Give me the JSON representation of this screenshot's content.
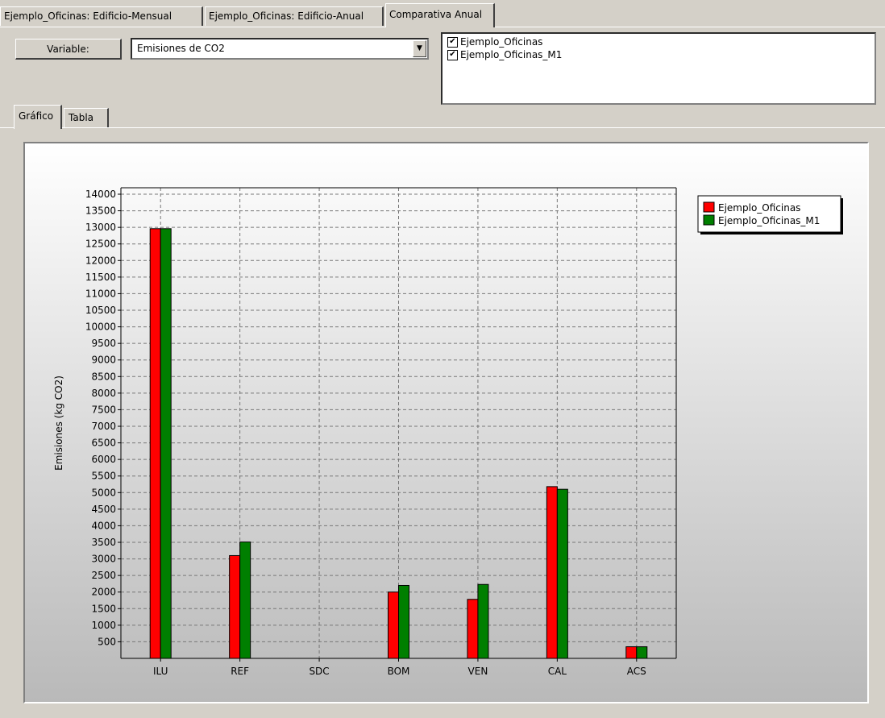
{
  "tabs": [
    {
      "label": "Ejemplo_Oficinas: Edificio-Mensual",
      "active": false
    },
    {
      "label": "Ejemplo_Oficinas: Edificio-Anual",
      "active": false
    },
    {
      "label": "Comparativa Anual",
      "active": true
    }
  ],
  "controls": {
    "variable_button": "Variable:",
    "variable_value": "Emisiones de CO2"
  },
  "cases": [
    {
      "label": "Ejemplo_Oficinas",
      "checked": true
    },
    {
      "label": "Ejemplo_Oficinas_M1",
      "checked": true
    }
  ],
  "subtabs": [
    {
      "label": "Gráfico",
      "active": true
    },
    {
      "label": "Tabla",
      "active": false
    }
  ],
  "colors": {
    "series1": "#ff0000",
    "series2": "#007f00"
  },
  "chart_data": {
    "type": "bar",
    "ylabel": "Emisiones (kg CO2)",
    "xlabel": "",
    "categories": [
      "ILU",
      "REF",
      "SDC",
      "BOM",
      "VEN",
      "CAL",
      "ACS"
    ],
    "ylim": [
      0,
      14000
    ],
    "yticks": [
      500,
      1000,
      1500,
      2000,
      2500,
      3000,
      3500,
      4000,
      4500,
      5000,
      5500,
      6000,
      6500,
      7000,
      7500,
      8000,
      8500,
      9000,
      9500,
      10000,
      10500,
      11000,
      11500,
      12000,
      12500,
      13000,
      13500,
      14000
    ],
    "grid": true,
    "legend": "top-right",
    "series": [
      {
        "name": "Ejemplo_Oficinas",
        "values": [
          12960,
          3100,
          0,
          2000,
          1780,
          5180,
          350
        ]
      },
      {
        "name": "Ejemplo_Oficinas_M1",
        "values": [
          12960,
          3510,
          0,
          2200,
          2230,
          5100,
          350
        ]
      }
    ]
  }
}
